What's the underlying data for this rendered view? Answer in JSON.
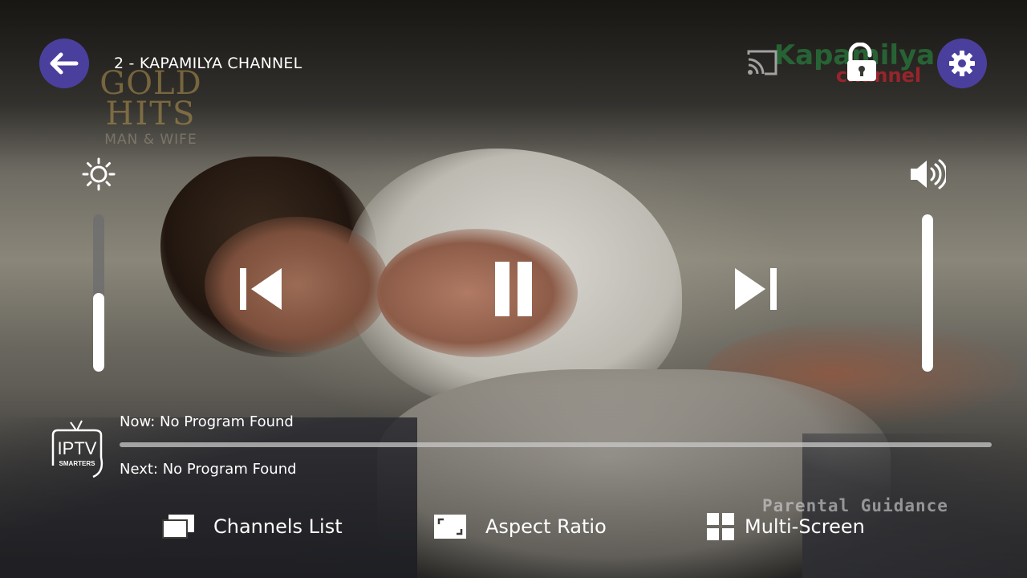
{
  "player": {
    "channel_title": "2 - KAPAMILYA CHANNEL",
    "brightness_level": 0.5,
    "volume_level": 1.0,
    "accent_color": "#4b3f9e"
  },
  "video_overlays": {
    "gold_hits_line1": "GOLD",
    "gold_hits_line2": "HITS",
    "gold_hits_line3": "MAN & WIFE",
    "network_logo_line1": "Kapamilya",
    "network_logo_line2": "channel",
    "rating": "Parental Guidance"
  },
  "epg": {
    "now": "Now: No Program Found",
    "next": "Next: No Program Found"
  },
  "logo": {
    "line1": "IPTV",
    "line2": "SMARTERS"
  },
  "bottom_bar": {
    "channels_list": "Channels List",
    "aspect_ratio": "Aspect Ratio",
    "multi_screen": "Multi-Screen"
  },
  "icons": {
    "back": "arrow-left-icon",
    "settings": "gear-icon",
    "cast": "cast-icon",
    "lock": "unlock-icon",
    "brightness": "sun-icon",
    "volume": "speaker-icon",
    "prev": "skip-previous-icon",
    "pause": "pause-icon",
    "next": "skip-next-icon"
  }
}
